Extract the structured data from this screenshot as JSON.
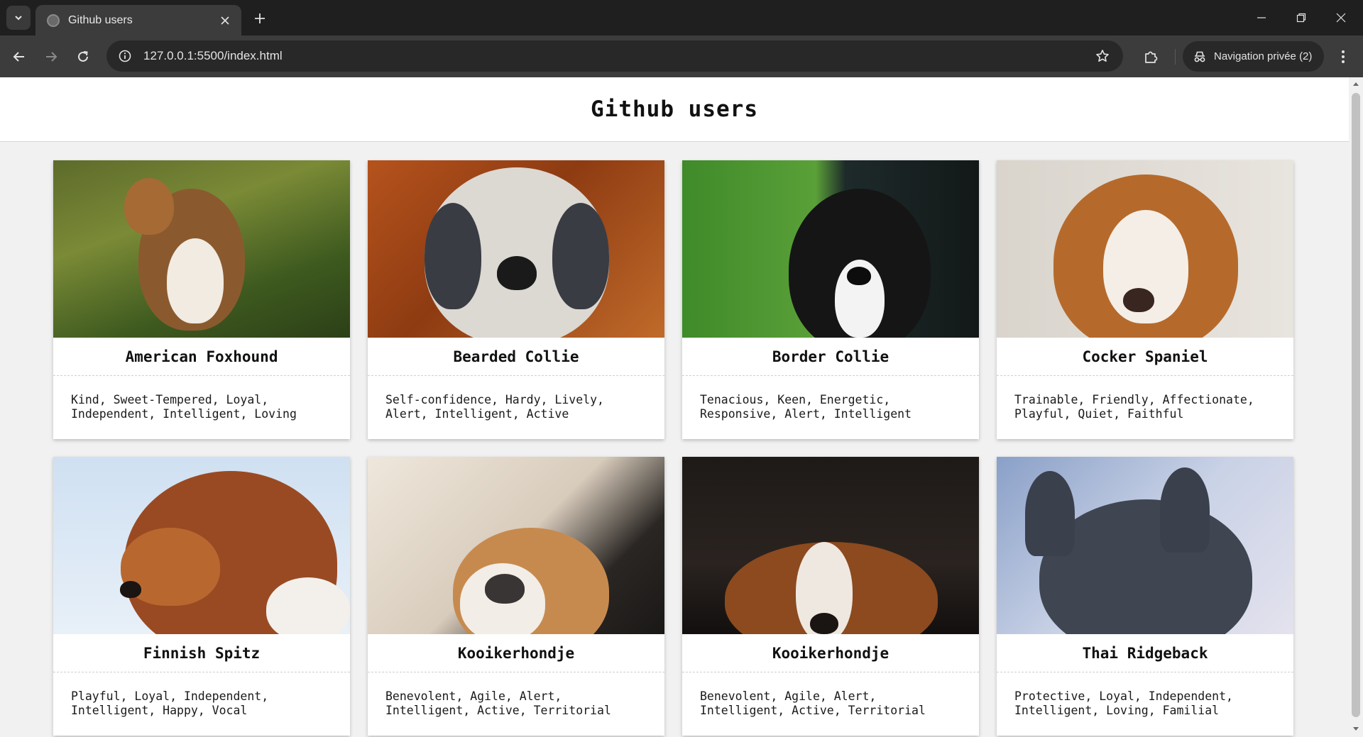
{
  "browser": {
    "tab_title": "Github users",
    "url": "127.0.0.1:5500/index.html",
    "incognito_label": "Navigation privée (2)"
  },
  "page": {
    "title": "Github users"
  },
  "cards": [
    {
      "name": "American Foxhound",
      "traits": "Kind, Sweet-Tempered, Loyal, Independent, Intelligent, Loving"
    },
    {
      "name": "Bearded Collie",
      "traits": "Self-confidence, Hardy, Lively, Alert, Intelligent, Active"
    },
    {
      "name": "Border Collie",
      "traits": "Tenacious, Keen, Energetic, Responsive, Alert, Intelligent"
    },
    {
      "name": "Cocker Spaniel",
      "traits": "Trainable, Friendly, Affectionate, Playful, Quiet, Faithful"
    },
    {
      "name": "Finnish Spitz",
      "traits": "Playful, Loyal, Independent, Intelligent, Happy, Vocal"
    },
    {
      "name": "Kooikerhondje",
      "traits": "Benevolent, Agile, Alert, Intelligent, Active, Territorial"
    },
    {
      "name": "Kooikerhondje",
      "traits": "Benevolent, Agile, Alert, Intelligent, Active, Territorial"
    },
    {
      "name": "Thai Ridgeback",
      "traits": "Protective, Loyal, Independent, Intelligent, Loving, Familial"
    }
  ]
}
